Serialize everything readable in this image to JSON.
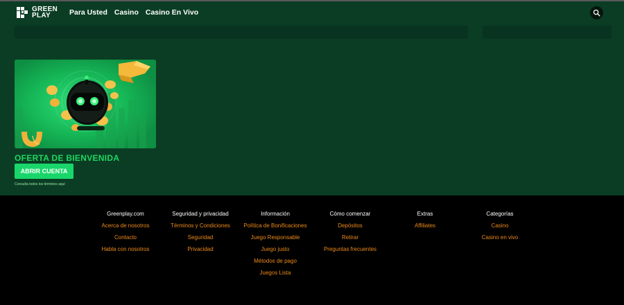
{
  "brand": {
    "logo_text_line1": "GREEN",
    "logo_text_line2": "PLAY"
  },
  "nav": {
    "links": [
      "Para Usted",
      "Casino",
      "Casino En Vivo"
    ],
    "search_icon": "search-icon"
  },
  "promo": {
    "title": "OFERTA DE BIENVENIDA",
    "button_label": "ABRIR CUENTA",
    "terms_link": "Consulta todos los términos aquí"
  },
  "footer": {
    "columns": [
      {
        "title": "Greenplay.com",
        "links": [
          "Acerca de nosotros",
          "Contacto",
          "Habla con nosotros"
        ]
      },
      {
        "title": "Seguridad y privacidad",
        "links": [
          "Términos y Condiciones",
          "Seguridad",
          "Privacidad"
        ]
      },
      {
        "title": "Información",
        "links": [
          "Política de Bonificaciones",
          "Juego Responsable",
          "Juego justo",
          "Métodos de pago",
          "Juegos Lista"
        ]
      },
      {
        "title": "Cómo comenzar",
        "links": [
          "Depósitos",
          "Retirar",
          "Preguntas frecuentes"
        ]
      },
      {
        "title": "Extras",
        "links": [
          "Affiliates"
        ]
      },
      {
        "title": "Categorías",
        "links": [
          "Casino",
          "Casino en vivo"
        ]
      }
    ]
  },
  "colors": {
    "page_bg": "#0b3d24",
    "accent_green": "#1ed760",
    "button_green": "#19d66a",
    "footer_link": "#ec8a1a",
    "footer_bg": "#000000"
  }
}
